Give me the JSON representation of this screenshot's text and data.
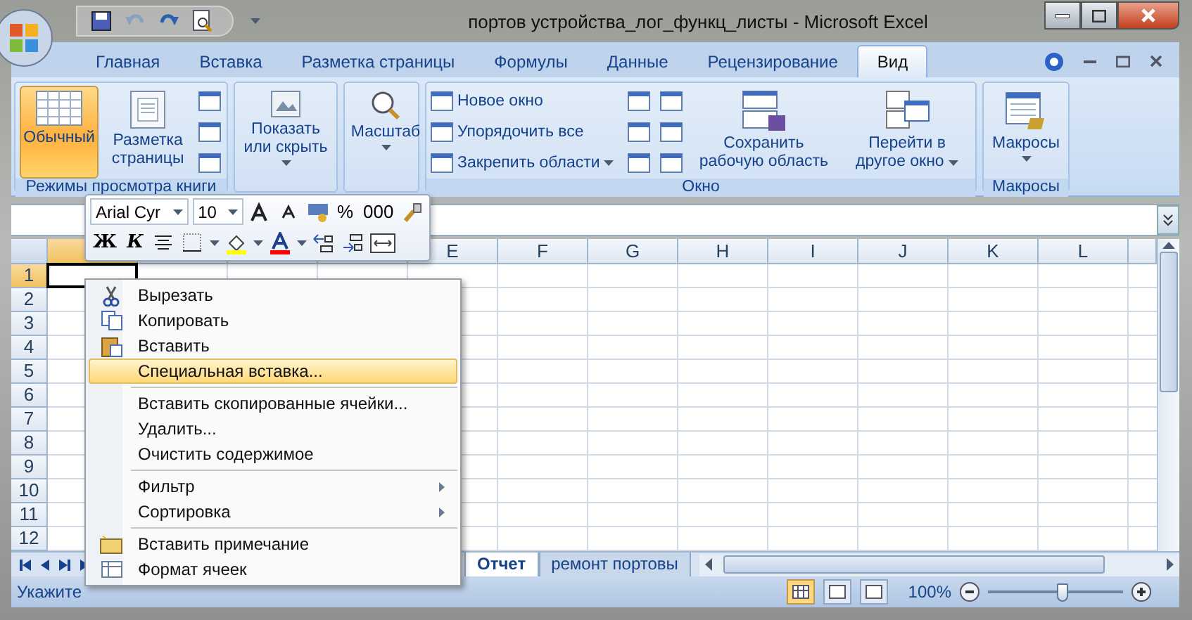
{
  "window": {
    "title": "портов устройства_лог_функц_листы - Microsoft Excel"
  },
  "tabs": [
    {
      "label": "Главная",
      "selected": false
    },
    {
      "label": "Вставка",
      "selected": false
    },
    {
      "label": "Разметка страницы",
      "selected": false
    },
    {
      "label": "Формулы",
      "selected": false
    },
    {
      "label": "Данные",
      "selected": false
    },
    {
      "label": "Рецензирование",
      "selected": false
    },
    {
      "label": "Вид",
      "selected": true
    }
  ],
  "ribbon": {
    "views": {
      "label": "Режимы просмотра книги",
      "buttons": [
        {
          "label": "Обычный",
          "selected": true
        },
        {
          "label": "Разметка страницы",
          "selected": false
        }
      ]
    },
    "show_hide": {
      "label": "Показать или скрыть"
    },
    "zoom": {
      "label": "Масштаб"
    },
    "window_group": {
      "label": "Окно",
      "commands": [
        "Новое окно",
        "Упорядочить все",
        "Закрепить области"
      ],
      "save": "Сохранить рабочую область",
      "switch": "Перейти в другое окно"
    },
    "macros_group": {
      "label": "Макросы",
      "button": "Макросы"
    }
  },
  "mini_toolbar": {
    "font": "Arial Cyr",
    "size": "10",
    "percent": "%",
    "thousands": "000",
    "bold": "Ж",
    "italic": "К"
  },
  "grid": {
    "columns": [
      {
        "selected": true
      },
      {
        "selected": false
      },
      {
        "selected": false
      },
      {
        "selected": false
      },
      {
        "label": "E",
        "selected": false
      },
      {
        "label": "F",
        "selected": false
      },
      {
        "label": "G",
        "selected": false
      },
      {
        "label": "H",
        "selected": false
      },
      {
        "label": "I",
        "selected": false
      },
      {
        "label": "J",
        "selected": false
      },
      {
        "label": "K",
        "selected": false
      },
      {
        "label": "L",
        "selected": false
      }
    ],
    "rows": [
      {
        "label": "1",
        "selected": true
      },
      {
        "label": "2",
        "selected": false
      },
      {
        "label": "3",
        "selected": false
      },
      {
        "label": "4",
        "selected": false
      },
      {
        "label": "5",
        "selected": false
      },
      {
        "label": "6",
        "selected": false
      },
      {
        "label": "7",
        "selected": false
      },
      {
        "label": "8",
        "selected": false
      },
      {
        "label": "9",
        "selected": false
      },
      {
        "label": "10",
        "selected": false
      },
      {
        "label": "11",
        "selected": false
      },
      {
        "label": "12",
        "selected": false
      }
    ]
  },
  "context_menu": {
    "groups": [
      [
        {
          "label": "Вырезать",
          "kind": "cut",
          "selected": false,
          "submenu": false
        },
        {
          "label": "Копировать",
          "kind": "copy",
          "selected": false,
          "submenu": false
        },
        {
          "label": "Вставить",
          "kind": "paste",
          "selected": false,
          "submenu": false
        },
        {
          "label": "Специальная вставка...",
          "kind": "plain",
          "selected": true,
          "submenu": false
        }
      ],
      [
        {
          "label": "Вставить скопированные ячейки...",
          "kind": "plain",
          "selected": false,
          "submenu": false
        },
        {
          "label": "Удалить...",
          "kind": "plain",
          "selected": false,
          "submenu": false
        },
        {
          "label": "Очистить содержимое",
          "kind": "plain",
          "selected": false,
          "submenu": false
        }
      ],
      [
        {
          "label": "Фильтр",
          "kind": "plain",
          "selected": false,
          "submenu": true
        },
        {
          "label": "Сортировка",
          "kind": "plain",
          "selected": false,
          "submenu": true
        }
      ],
      [
        {
          "label": "Вставить примечание",
          "kind": "comment",
          "selected": false,
          "submenu": false
        },
        {
          "label": "Формат ячеек",
          "kind": "format",
          "selected": false,
          "submenu": false
        }
      ]
    ]
  },
  "sheet_tabs": [
    {
      "label": "Отчет",
      "selected": true
    },
    {
      "label": "ремонт портовы",
      "selected": false
    }
  ],
  "status_bar": {
    "text": "Укажите",
    "views": [
      {
        "selected": true
      },
      {
        "selected": false
      },
      {
        "selected": false
      }
    ],
    "zoom": "100%",
    "zoom_slider": {
      "level": 0.55
    }
  }
}
